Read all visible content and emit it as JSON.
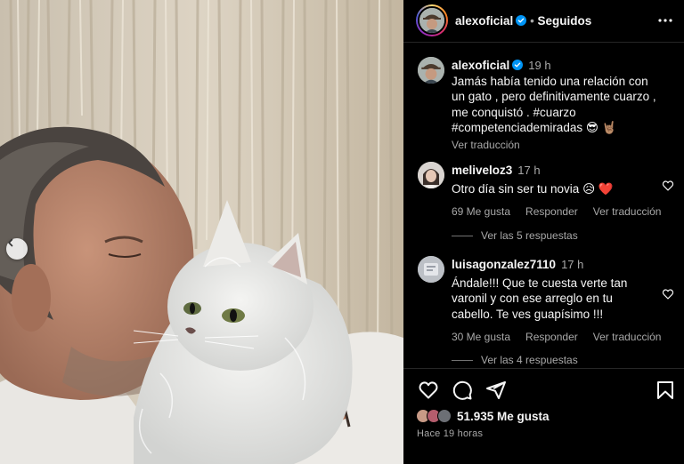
{
  "post": {
    "author": "alexoficial",
    "follow_status": "Seguidos",
    "caption": {
      "author": "alexoficial",
      "time": "19 h",
      "text": "Jamás había tenido una relación con un gato , pero definitivamente cuarzo , me conquistó . #cuarzo #competenciademiradas 😎 🤘🏽",
      "translate": "Ver traducción"
    },
    "comments": [
      {
        "author": "meliveloz3",
        "time": "17 h",
        "text": "Otro día sin ser tu novia 😥 ❤️",
        "likes": "69 Me gusta",
        "reply": "Responder",
        "translate": "Ver traducción",
        "replies": "Ver las 5 respuestas"
      },
      {
        "author": "luisagonzalez7110",
        "time": "17 h",
        "text": "Ándale!!! Que te cuesta verte tan varonil y con ese arreglo en tu cabello. Te ves guapísimo !!!",
        "likes": "30 Me gusta",
        "reply": "Responder",
        "translate": "Ver traducción",
        "replies": "Ver las 4 respuestas"
      }
    ],
    "likes": "51.935 Me gusta",
    "posted": "Hace 19 horas"
  },
  "colors": {
    "background": "#000000",
    "verified": "#0095f6",
    "muted_text": "#a8a8a8"
  },
  "icons": [
    "more-options-icon",
    "verified-badge-icon",
    "heart-icon",
    "comment-icon",
    "share-icon",
    "bookmark-icon",
    "chevron-left-icon"
  ]
}
